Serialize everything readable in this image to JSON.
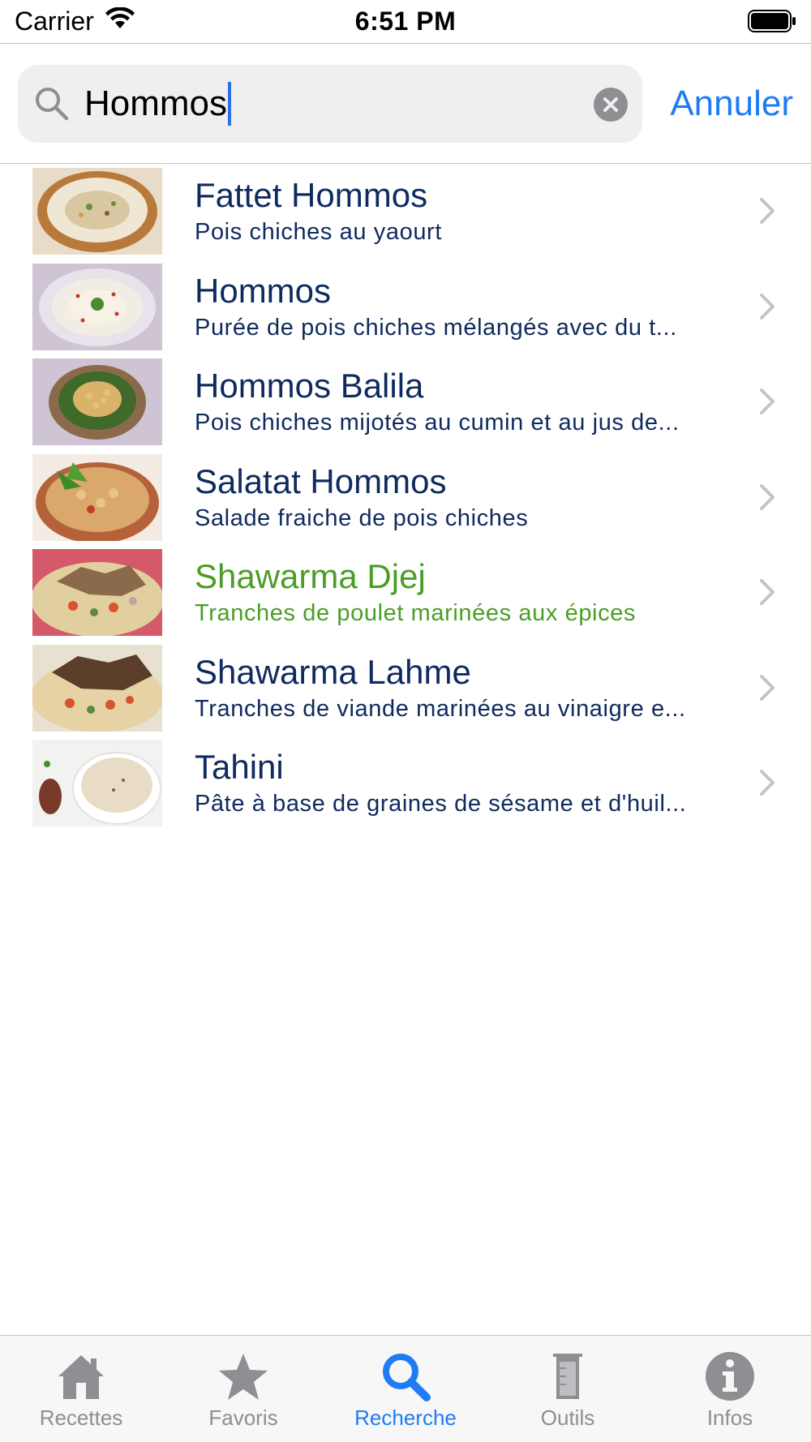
{
  "status_bar": {
    "carrier": "Carrier",
    "time": "6:51 PM"
  },
  "search": {
    "query": "Hommos",
    "cancel_label": "Annuler"
  },
  "results": [
    {
      "title": "Fattet Hommos",
      "subtitle": "Pois chiches au yaourt",
      "thumb": "fattet-hommos-photo"
    },
    {
      "title": "Hommos",
      "subtitle": "Purée de pois chiches mélangés avec du t...",
      "thumb": "hommos-photo"
    },
    {
      "title": "Hommos Balila",
      "subtitle": "Pois chiches mijotés au cumin et au jus de...",
      "thumb": "hommos-balila-photo"
    },
    {
      "title": "Salatat Hommos",
      "subtitle": "Salade fraiche de pois chiches",
      "thumb": "salatat-hommos-photo"
    },
    {
      "title": "Shawarma Djej",
      "subtitle": "Tranches de poulet marinées aux épices",
      "thumb": "shawarma-djej-photo"
    },
    {
      "title": "Shawarma Lahme",
      "subtitle": "Tranches de viande marinées au vinaigre e...",
      "thumb": "shawarma-lahme-photo"
    },
    {
      "title": "Tahini",
      "subtitle": "Pâte à base de graines de sésame et d'huil...",
      "thumb": "tahini-photo"
    }
  ],
  "tabs": [
    {
      "label": "Recettes",
      "icon": "house-icon"
    },
    {
      "label": "Favoris",
      "icon": "star-icon"
    },
    {
      "label": "Recherche",
      "icon": "search-icon"
    },
    {
      "label": "Outils",
      "icon": "beaker-icon"
    },
    {
      "label": "Infos",
      "icon": "info-icon"
    }
  ],
  "colors": {
    "accent": "#1f7cf5",
    "title_text": "#0f2a5e",
    "highlight_green": "#4a9e25",
    "inactive_tab": "#8e8e93"
  }
}
